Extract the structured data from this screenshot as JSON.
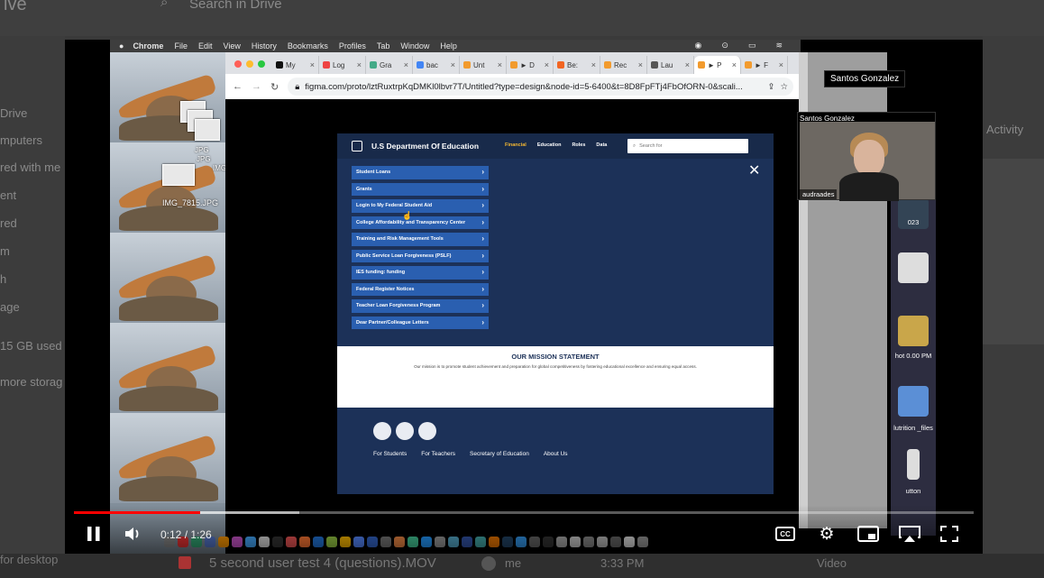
{
  "mac_menubar": {
    "apple": "",
    "items": [
      "Chrome",
      "File",
      "Edit",
      "View",
      "History",
      "Bookmarks",
      "Profiles",
      "Tab",
      "Window",
      "Help"
    ]
  },
  "desktop_files": {
    "labels": [
      "JPG",
      "JPG",
      "IMG",
      "IMG_7815.JPG"
    ]
  },
  "browser": {
    "tabs": [
      {
        "label": "My",
        "color": "#111"
      },
      {
        "label": "Log",
        "color": "#e44"
      },
      {
        "label": "Gra",
        "color": "#4a8"
      },
      {
        "label": "bac",
        "color": "#4285f4"
      },
      {
        "label": "Unt",
        "color": "#f29b2e"
      },
      {
        "label": "► D",
        "color": "#f29b2e"
      },
      {
        "label": "Be:",
        "color": "#f26522"
      },
      {
        "label": "Rec",
        "color": "#f29b2e"
      },
      {
        "label": "Lau",
        "color": "#555"
      },
      {
        "label": "► P",
        "color": "#f29b2e"
      },
      {
        "label": "► F",
        "color": "#f29b2e"
      }
    ],
    "url": "figma.com/proto/lztRuxtrpKqDMKl0lbvr7T/Untitled?type=design&node-id=5-6400&t=8D8FpFTj4FbOfORN-0&scali..."
  },
  "site": {
    "title": "U.S Department Of Education",
    "nav": [
      "Financial",
      "Education",
      "Roles",
      "Data"
    ],
    "search_placeholder": "Search for",
    "menu": [
      "Student Loans",
      "Grants",
      "Login to My Federal Student Aid",
      "College Affordability and Transparency Center",
      "Training and Risk Management Tools",
      "Public Service Loan Forgiveness (PSLF)",
      "IES funding: funding",
      "Federal Register Notices",
      "Teacher Loan Forgiveness Program",
      "Dear Partner/Colleague Letters"
    ],
    "mission_title": "OUR MISSION STATEMENT",
    "mission_text": "Our mission is to promote student achievement and preparation for global competitiveness by fostering educational excellence and ensuring equal access.",
    "footer_links": [
      "For Students",
      "For Teachers",
      "Secretary of Education",
      "About Us"
    ]
  },
  "meeting": {
    "speaker_name": "Santos Gonzalez",
    "tile_name": "Santos Gonzalez",
    "participant_tag": "audraades"
  },
  "desktop_icons": [
    "023",
    "hot 0.00 PM",
    "lutrition _files",
    "utton"
  ],
  "player": {
    "current_time": "0:12",
    "separator": " / ",
    "duration": "1:26",
    "played_fraction": 0.14,
    "loaded_fraction": 0.25,
    "cc_label": "CC"
  },
  "drive_background": {
    "search": "Search in Drive",
    "side_labels": [
      "Drive",
      "mputers",
      "red with me",
      "ent",
      "red",
      "m",
      "h",
      "age",
      "15 GB used",
      "more storag",
      "for desktop"
    ],
    "activity": "Activity",
    "row_name": "5 second user test 4 (questions).MOV",
    "row_owner": "me",
    "row_time": "3:33 PM",
    "row_type": "Video"
  }
}
